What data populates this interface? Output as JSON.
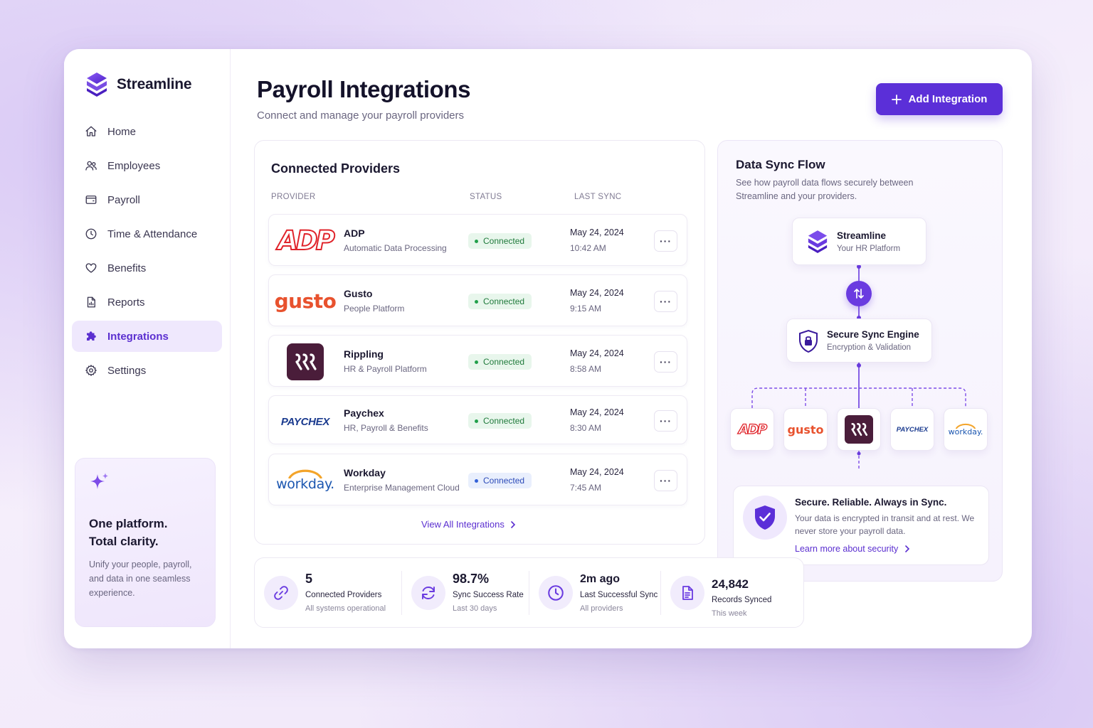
{
  "brand": {
    "name": "Streamline"
  },
  "nav": [
    {
      "label": "Home",
      "icon": "home-icon"
    },
    {
      "label": "Employees",
      "icon": "users-icon"
    },
    {
      "label": "Payroll",
      "icon": "wallet-icon"
    },
    {
      "label": "Time & Attendance",
      "icon": "clock-icon"
    },
    {
      "label": "Benefits",
      "icon": "heart-icon"
    },
    {
      "label": "Reports",
      "icon": "report-icon"
    },
    {
      "label": "Integrations",
      "icon": "puzzle-icon",
      "active": true
    },
    {
      "label": "Settings",
      "icon": "gear-icon"
    }
  ],
  "promo": {
    "title_line1": "One platform.",
    "title_line2": "Total clarity.",
    "text": "Unify your people, payroll, and data in one seamless experience."
  },
  "header": {
    "title": "Payroll Integrations",
    "subtitle": "Connect and manage your payroll providers",
    "add_button": "Add Integration"
  },
  "providers": {
    "title": "Connected Providers",
    "columns": {
      "provider": "PROVIDER",
      "status": "STATUS",
      "last_sync": "LAST SYNC"
    },
    "rows": [
      {
        "logo": "ADP",
        "name": "ADP",
        "desc": "Automatic Data Processing",
        "status": "Connected",
        "date": "May 24, 2024",
        "time": "10:42 AM"
      },
      {
        "logo": "gusto",
        "name": "Gusto",
        "desc": "People Platform",
        "status": "Connected",
        "date": "May 24, 2024",
        "time": "9:15 AM"
      },
      {
        "logo": "rippling",
        "name": "Rippling",
        "desc": "HR & Payroll Platform",
        "status": "Connected",
        "date": "May 24, 2024",
        "time": "8:58 AM"
      },
      {
        "logo": "PAYCHEX",
        "name": "Paychex",
        "desc": "HR, Payroll & Benefits",
        "status": "Connected",
        "date": "May 24, 2024",
        "time": "8:30 AM"
      },
      {
        "logo": "workday.",
        "name": "Workday",
        "desc": "Enterprise Management Cloud",
        "status": "Connected",
        "date": "May 24, 2024",
        "time": "7:45 AM"
      }
    ],
    "view_all": "View All Integrations"
  },
  "flow": {
    "title": "Data Sync Flow",
    "subtitle": "See how payroll data flows securely between Streamline and your providers.",
    "top_node": {
      "title": "Streamline",
      "sub": "Your HR Platform"
    },
    "engine_node": {
      "title": "Secure Sync Engine",
      "sub": "Encryption & Validation"
    },
    "secure": {
      "title": "Secure. Reliable. Always in Sync.",
      "text": "Your data is encrypted in transit and at rest. We never store your payroll data.",
      "link": "Learn more about security"
    }
  },
  "stats": [
    {
      "value": "5",
      "label": "Connected Providers",
      "sub": "All systems operational",
      "icon": "link-icon"
    },
    {
      "value": "98.7%",
      "label": "Sync Success Rate",
      "sub": "Last 30 days",
      "icon": "refresh-icon"
    },
    {
      "value": "2m ago",
      "label": "Last Successful Sync",
      "sub": "All providers",
      "icon": "clock-icon"
    },
    {
      "value": "24,842",
      "label": "Records Synced",
      "sub": "This week",
      "icon": "document-icon"
    }
  ],
  "colors": {
    "accent": "#5b2fd8",
    "connected_bg": "#e8f6ec",
    "connected_text": "#1f7a3b"
  }
}
